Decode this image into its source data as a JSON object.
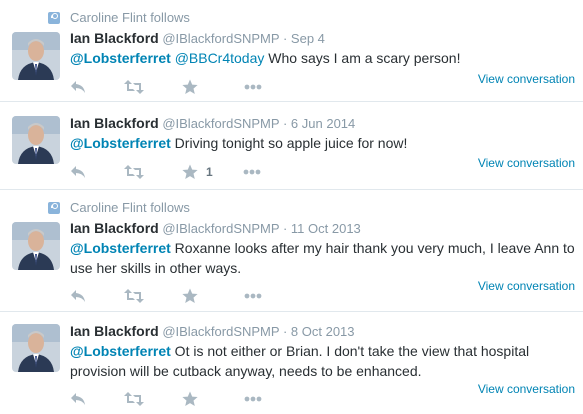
{
  "colors": {
    "link": "#0084b4",
    "muted": "#8899a6",
    "icon": "#aab8c2",
    "border": "#e1e8ed"
  },
  "tweets": [
    {
      "context": "Caroline Flint follows",
      "fullname": "Ian Blackford",
      "handle": "@IBlackfordSNPMP",
      "sep": "·",
      "time": "Sep 4",
      "mentions": [
        "@Lobsterferret",
        "@BBCr4today"
      ],
      "text": " Who says I am a scary person!",
      "star_count": "",
      "view_label": "View conversation"
    },
    {
      "context": "",
      "fullname": "Ian Blackford",
      "handle": "@IBlackfordSNPMP",
      "sep": "·",
      "time": "6 Jun 2014",
      "mentions": [
        "@Lobsterferret"
      ],
      "text": " Driving tonight so apple juice for now!",
      "star_count": "1",
      "view_label": "View conversation"
    },
    {
      "context": "Caroline Flint follows",
      "fullname": "Ian Blackford",
      "handle": "@IBlackfordSNPMP",
      "sep": "·",
      "time": "11 Oct 2013",
      "mentions": [
        "@Lobsterferret"
      ],
      "text": " Roxanne looks after my hair thank you very much, I leave Ann to use her skills in other ways.",
      "star_count": "",
      "view_label": "View conversation"
    },
    {
      "context": "",
      "fullname": "Ian Blackford",
      "handle": "@IBlackfordSNPMP",
      "sep": "·",
      "time": "8 Oct 2013",
      "mentions": [
        "@Lobsterferret"
      ],
      "text": " Ot is not either or Brian. I don't take the view that hospital provision will be cutback anyway, needs to be enhanced.",
      "star_count": "",
      "view_label": "View conversation"
    }
  ],
  "icons": [
    "follow-context-icon",
    "reply-icon",
    "retweet-icon",
    "favorite-star-icon",
    "more-dots-icon"
  ]
}
